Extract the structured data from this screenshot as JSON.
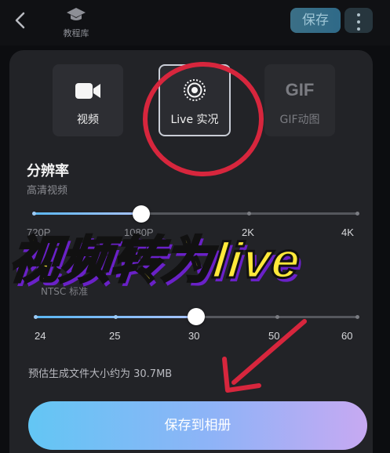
{
  "header": {
    "tutorial_label": "教程库",
    "save_label": "保存"
  },
  "formats": [
    {
      "label": "视频",
      "icon": "video-camera-icon"
    },
    {
      "label": "Live 实况",
      "icon": "live-photo-icon",
      "selected": true
    },
    {
      "label": "GIF动图",
      "icon_text": "GIF"
    }
  ],
  "resolution": {
    "title": "分辨率",
    "subtitle": "高清视频",
    "ticks": [
      "720P",
      "1080P",
      "2K",
      "4K"
    ]
  },
  "framerate": {
    "label": "NTSC 标准",
    "ticks": [
      "24",
      "25",
      "30",
      "50",
      "60"
    ],
    "selected": "30"
  },
  "overlay_caption": "视频转为live",
  "estimate_text": "预估生成文件大小约为 30.7MB",
  "cta_label": "保存到相册",
  "colors": {
    "accent_blue": "#63c6f4",
    "accent_purple": "#c7a9f2",
    "highlight_red": "#d7263d",
    "caption_yellow": "#ffe93a"
  }
}
